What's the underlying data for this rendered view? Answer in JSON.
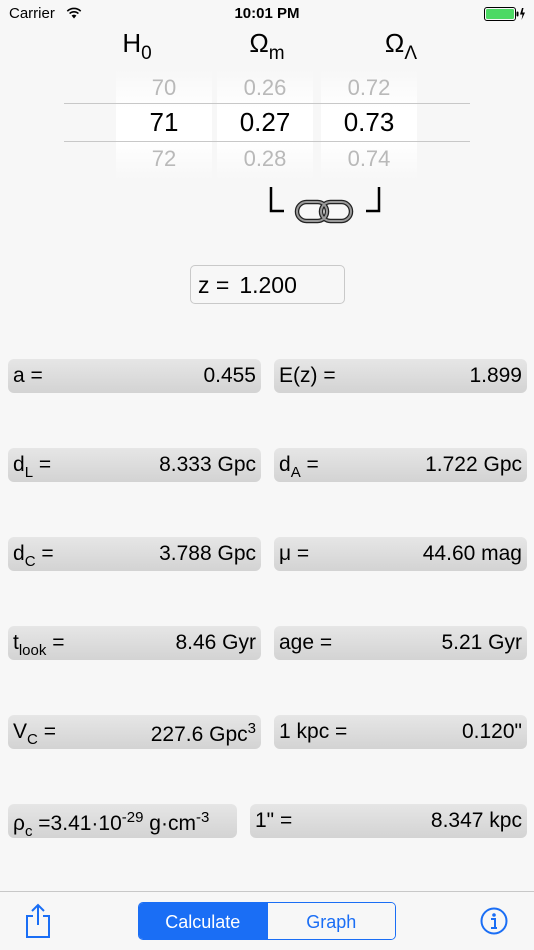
{
  "status_bar": {
    "carrier": "Carrier",
    "time": "10:01 PM"
  },
  "picker": {
    "headers": {
      "h0_symbol": "H",
      "h0_sub": "0",
      "om_symbol": "Ω",
      "om_sub": "m",
      "ol_symbol": "Ω",
      "ol_sub": "Λ"
    },
    "h0": {
      "prev": "70",
      "selected": "71",
      "next": "72"
    },
    "omega_m": {
      "prev": "0.26",
      "selected": "0.27",
      "next": "0.28"
    },
    "omega_lambda": {
      "prev": "0.72",
      "selected": "0.73",
      "next": "0.74"
    }
  },
  "redshift": {
    "label": "z =",
    "value": "1.200"
  },
  "results": {
    "a": {
      "label": "a =",
      "value": "0.455"
    },
    "ez": {
      "label": "E(z) =",
      "value": "1.899"
    },
    "dl": {
      "label_main": "d",
      "label_sub": "L",
      "label_tail": " =",
      "value": "8.333 Gpc"
    },
    "da": {
      "label_main": "d",
      "label_sub": "A",
      "label_tail": " =",
      "value": "1.722 Gpc"
    },
    "dc": {
      "label_main": "d",
      "label_sub": "C",
      "label_tail": " =",
      "value": "3.788 Gpc"
    },
    "mu": {
      "label": "μ =",
      "value": "44.60 mag"
    },
    "tlook": {
      "label_main": "t",
      "label_sub": "look",
      "label_tail": " =",
      "value": "8.46 Gyr"
    },
    "age": {
      "label": "age =",
      "value": "5.21 Gyr"
    },
    "vc": {
      "label_main": "V",
      "label_sub": "C",
      "label_tail": " =",
      "value_main": "227.6 Gpc",
      "value_sup": "3"
    },
    "kpc": {
      "label": "1 kpc =",
      "value": "0.120\""
    },
    "rhoc": {
      "label_main": "ρ",
      "label_sub": "c",
      "label_tail": " =3.41·10",
      "exp1": "-29",
      "unit": " g·cm",
      "exp2": "-3"
    },
    "arcsec": {
      "label": "1\" =",
      "value": "8.347 kpc"
    }
  },
  "toolbar": {
    "calculate_label": "Calculate",
    "graph_label": "Graph",
    "active_segment": "Calculate"
  },
  "colors": {
    "accent": "#1a6ef5",
    "battery": "#4cd964"
  }
}
